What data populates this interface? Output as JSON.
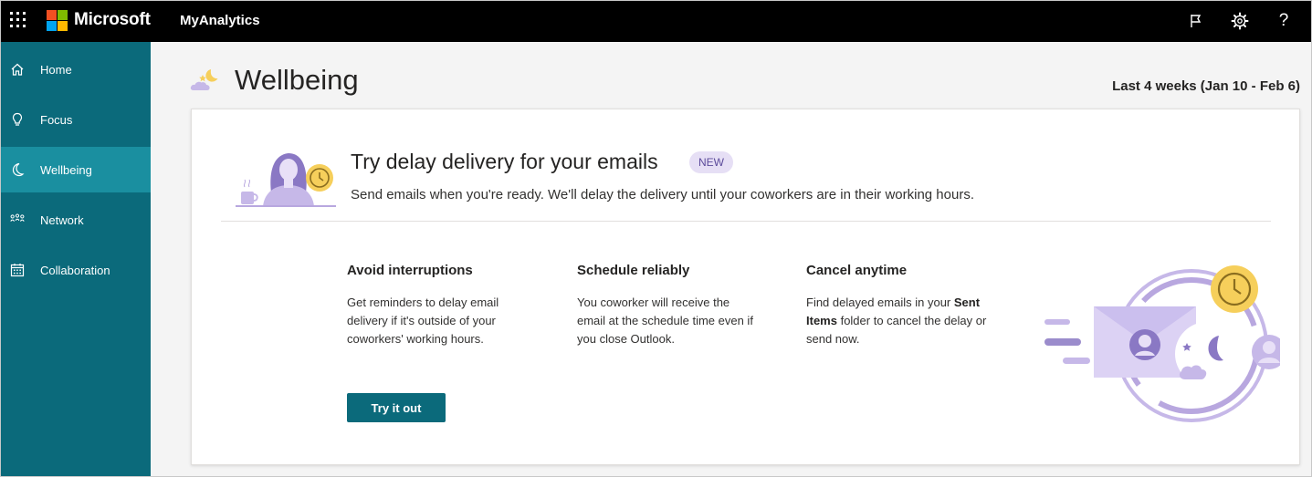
{
  "topbar": {
    "brand": "Microsoft",
    "app_title": "MyAnalytics",
    "icons": [
      "waffle-icon",
      "flag-icon",
      "gear-icon",
      "help-icon"
    ],
    "help_glyph": "?",
    "background": "#000000"
  },
  "sidebar": {
    "background": "#0b6a7b",
    "active_background": "#1a8fa0",
    "items": [
      {
        "label": "Home",
        "icon": "home-icon",
        "active": false
      },
      {
        "label": "Focus",
        "icon": "lightbulb-icon",
        "active": false
      },
      {
        "label": "Wellbeing",
        "icon": "moon-icon",
        "active": true
      },
      {
        "label": "Network",
        "icon": "network-icon",
        "active": false
      },
      {
        "label": "Collaboration",
        "icon": "calendar-icon",
        "active": false
      }
    ]
  },
  "header": {
    "title": "Wellbeing",
    "date_range": "Last 4 weeks (Jan 10 - Feb 6)"
  },
  "card": {
    "title": "Try delay delivery for your emails",
    "badge": "NEW",
    "subtitle": "Send emails when you're ready. We'll delay the delivery until your coworkers are in their working hours.",
    "columns": [
      {
        "heading": "Avoid interruptions",
        "body": "Get reminders to delay email delivery if it's outside of your coworkers' working hours."
      },
      {
        "heading": "Schedule reliably",
        "body": "You coworker will receive the email at the schedule time even if you close Outlook."
      },
      {
        "heading": "Cancel anytime",
        "body_pre": "Find delayed emails in your ",
        "body_bold": "Sent Items",
        "body_post": " folder to cancel the delay or send now."
      }
    ],
    "button_label": "Try it out"
  },
  "colors": {
    "accent": "#0b6a7b",
    "badge_bg": "#e6dff5",
    "illustration_purple": "#b8a7df",
    "clock_yellow": "#f6cf5b"
  }
}
